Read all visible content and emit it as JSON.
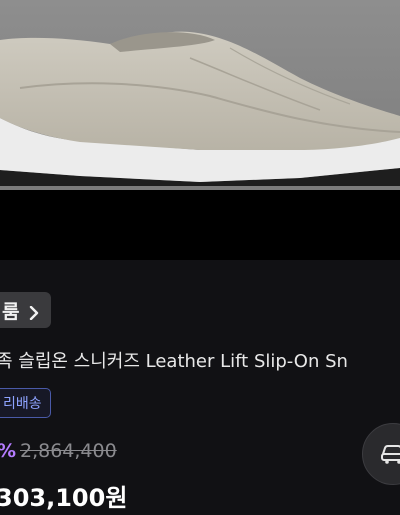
{
  "product": {
    "brand_link_label": "룸",
    "name": "하이 리프트 슬립온 스니커즈 Leather Lift Slip-On Sneakers",
    "name_visible": "족 슬립온 스니커즈 Leather Lift Slip-On Sn",
    "delivery_badge": "리배송",
    "discount_rate": "%",
    "original_price": "2,864,400",
    "sale_price": "303,100원"
  },
  "icons": {
    "brand_chevron": "chevron-right-icon",
    "fab": "car-shopping-icon"
  },
  "colors": {
    "background": "#111114",
    "accent_purple": "#b57cff",
    "badge_blue": "#8ea3ff",
    "price_strike": "#8a8a8e"
  }
}
